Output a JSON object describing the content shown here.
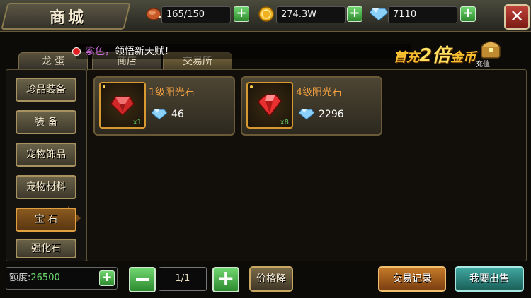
{
  "header": {
    "title": "商城",
    "resources": [
      {
        "icon": "meat-icon",
        "value": "165/150"
      },
      {
        "icon": "gold-coin-icon",
        "value": "274.3W"
      },
      {
        "icon": "diamond-icon",
        "value": "7110"
      }
    ],
    "close_label": "✕"
  },
  "notice": {
    "prefix": "紫色，",
    "text": "领悟新天赋！"
  },
  "promo": {
    "part1": "首充",
    "highlight": "2倍",
    "part2": "金币",
    "recharge_label": "充值"
  },
  "tabs": {
    "dragon_egg": "龙 蛋",
    "shop": "商店",
    "exchange": "交易所"
  },
  "categories": [
    {
      "label": "珍品装备",
      "active": false
    },
    {
      "label": "装 备",
      "active": false
    },
    {
      "label": "宠物饰品",
      "active": false
    },
    {
      "label": "宠物材料",
      "active": false
    },
    {
      "label": "宝 石",
      "active": true
    },
    {
      "label": "强化石",
      "active": false
    }
  ],
  "items": [
    {
      "name": "1级阳光石",
      "price": "46",
      "count": "x1",
      "gem_color": "#d02828"
    },
    {
      "name": "4级阳光石",
      "price": "2296",
      "count": "x8",
      "gem_color": "#e83030"
    }
  ],
  "footer": {
    "quota_label": "额度:",
    "quota_value": "26500",
    "page": "1/1",
    "price_sort": "价格降",
    "trade_log": "交易记录",
    "sell": "我要出售"
  },
  "colors": {
    "accent_gold": "#d89a30",
    "plus_green": "#2e8a2e",
    "sell_teal": "#3fa8a0"
  }
}
